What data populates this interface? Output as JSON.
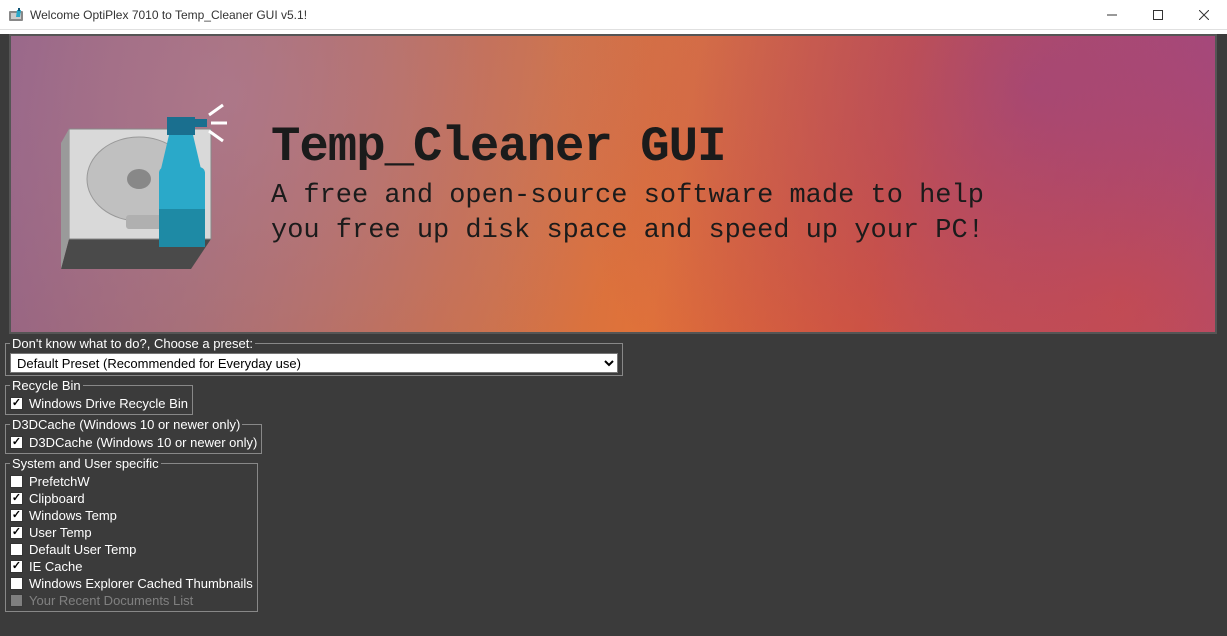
{
  "window": {
    "title": "Welcome OptiPlex 7010 to Temp_Cleaner GUI v5.1!"
  },
  "banner": {
    "heading": "Temp_Cleaner GUI",
    "subheading": "A free and open-source software made to help you free up disk space and speed up your PC!"
  },
  "preset": {
    "legend": "Don't know what to do?, Choose a preset:",
    "selected": "Default Preset (Recommended for Everyday use)"
  },
  "groups": [
    {
      "legend": "Recycle Bin",
      "items": [
        {
          "label": "Windows Drive Recycle Bin",
          "checked": true
        }
      ]
    },
    {
      "legend": "D3DCache (Windows 10 or newer only)",
      "items": [
        {
          "label": "D3DCache (Windows 10 or newer only)",
          "checked": true
        }
      ]
    },
    {
      "legend": "System and User specific",
      "items": [
        {
          "label": "PrefetchW",
          "checked": false
        },
        {
          "label": "Clipboard",
          "checked": true
        },
        {
          "label": "Windows Temp",
          "checked": true
        },
        {
          "label": "User Temp",
          "checked": true
        },
        {
          "label": "Default User Temp",
          "checked": false
        },
        {
          "label": "IE Cache",
          "checked": true
        },
        {
          "label": "Windows Explorer Cached Thumbnails",
          "checked": false
        },
        {
          "label": "Your Recent Documents List",
          "checked": false
        }
      ]
    }
  ]
}
